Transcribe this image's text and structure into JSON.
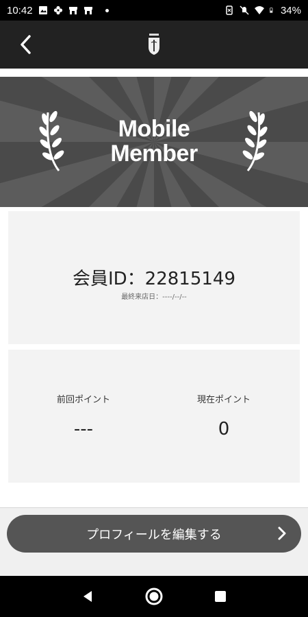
{
  "status_bar": {
    "time": "10:42",
    "battery": "34%",
    "left_icons": [
      "image-icon",
      "flower-icon",
      "shop-icon",
      "shop-icon",
      "dot-icon"
    ],
    "right_icons": [
      "nfc-icon",
      "mute-icon",
      "wifi-icon",
      "battery-icon"
    ]
  },
  "header": {
    "back_icon": "chevron-left-icon",
    "logo_icon": "brand-logo-icon"
  },
  "banner": {
    "title_line1": "Mobile",
    "title_line2": "Member",
    "background_color": "#4a4a4a",
    "ray_color": "#5c5c5c"
  },
  "member": {
    "id_text": "会員ID：22815149",
    "last_visit": "最終来店日：----/--/--"
  },
  "points": {
    "previous_label": "前回ポイント",
    "previous_value": "---",
    "current_label": "現在ポイント",
    "current_value": "0"
  },
  "actions": {
    "edit_profile_label": "プロフィールを編集する",
    "button_color": "#555555"
  },
  "nav": {
    "back": "nav-back-icon",
    "home": "nav-home-icon",
    "recents": "nav-recents-icon"
  }
}
